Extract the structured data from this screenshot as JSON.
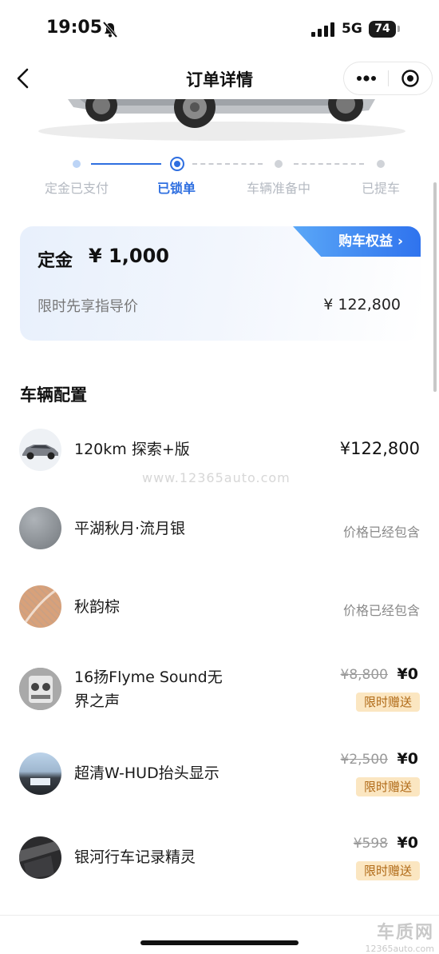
{
  "status_bar": {
    "time": "19:05",
    "network": "5G",
    "battery": "74"
  },
  "nav": {
    "title": "订单详情"
  },
  "progress": {
    "steps": [
      {
        "label": "定金已支付"
      },
      {
        "label": "已锁单"
      },
      {
        "label": "车辆准备中"
      },
      {
        "label": "已提车"
      }
    ],
    "current_index": 1
  },
  "deposit": {
    "label": "定金",
    "amount": "¥ 1,000",
    "benefit": "购车权益 ›",
    "guide_label": "限时先享指导价",
    "guide_price": "¥ 122,800"
  },
  "config": {
    "title": "车辆配置",
    "items": [
      {
        "name": "120km 探索+版",
        "price": "¥122,800"
      },
      {
        "name": "平湖秋月·流月银",
        "included": "价格已经包含"
      },
      {
        "name": "秋韵棕",
        "included": "价格已经包含"
      },
      {
        "name": "16扬Flyme Sound无界之声",
        "name_line1": "16扬Flyme Sound无",
        "name_line2": "界之声",
        "original": "¥8,800",
        "now": "¥0",
        "tag": "限时赠送"
      },
      {
        "name": "超清W-HUD抬头显示",
        "original": "¥2,500",
        "now": "¥0",
        "tag": "限时赠送"
      },
      {
        "name": "银河行车记录精灵",
        "original": "¥598",
        "now": "¥0",
        "tag": "限时赠送"
      }
    ]
  },
  "watermark": "www.12365auto.com",
  "corner_logo": {
    "name": "车质网",
    "url": "12365auto.com"
  },
  "colors": {
    "accent": "#2f6fe0",
    "gift_bg": "#fbe6c1",
    "gift_text": "#b06a17"
  }
}
